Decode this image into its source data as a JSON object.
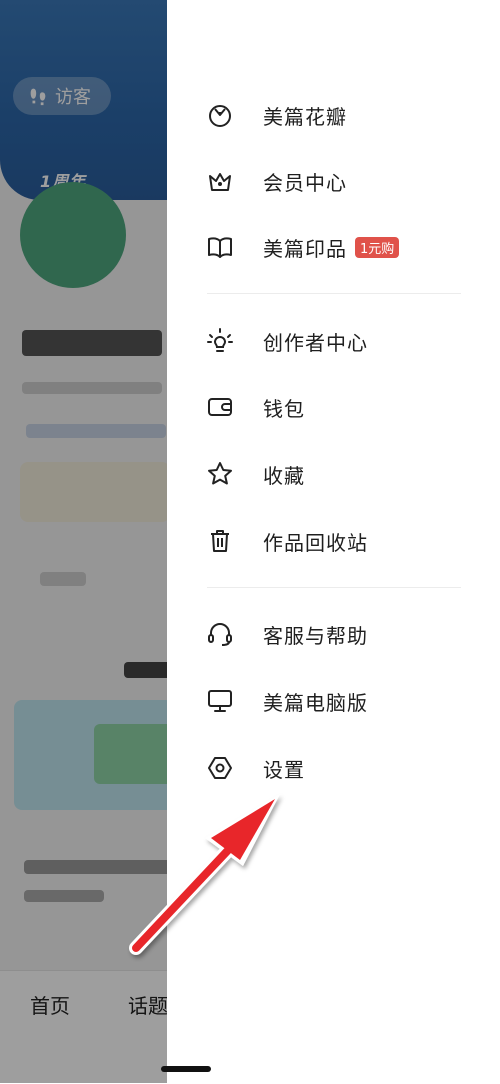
{
  "background": {
    "visitor_label": "访客",
    "anniversary_text": "1周年",
    "tabs": [
      "首页",
      "话题"
    ]
  },
  "menu": {
    "section1": [
      {
        "label": "美篇花瓣",
        "icon": "petal-icon"
      },
      {
        "label": "会员中心",
        "icon": "crown-icon"
      },
      {
        "label": "美篇印品",
        "icon": "book-icon",
        "badge": "1元购"
      }
    ],
    "section2": [
      {
        "label": "创作者中心",
        "icon": "lightbulb-icon"
      },
      {
        "label": "钱包",
        "icon": "wallet-icon"
      },
      {
        "label": "收藏",
        "icon": "star-icon"
      },
      {
        "label": "作品回收站",
        "icon": "trash-icon"
      }
    ],
    "section3": [
      {
        "label": "客服与帮助",
        "icon": "headset-icon"
      },
      {
        "label": "美篇电脑版",
        "icon": "monitor-icon"
      },
      {
        "label": "设置",
        "icon": "settings-icon"
      }
    ]
  },
  "colors": {
    "badge": "#e0524a",
    "header_blue": "#2c66a8",
    "avatar_green": "#4ea77f",
    "annotation_arrow": "#e8262b"
  }
}
